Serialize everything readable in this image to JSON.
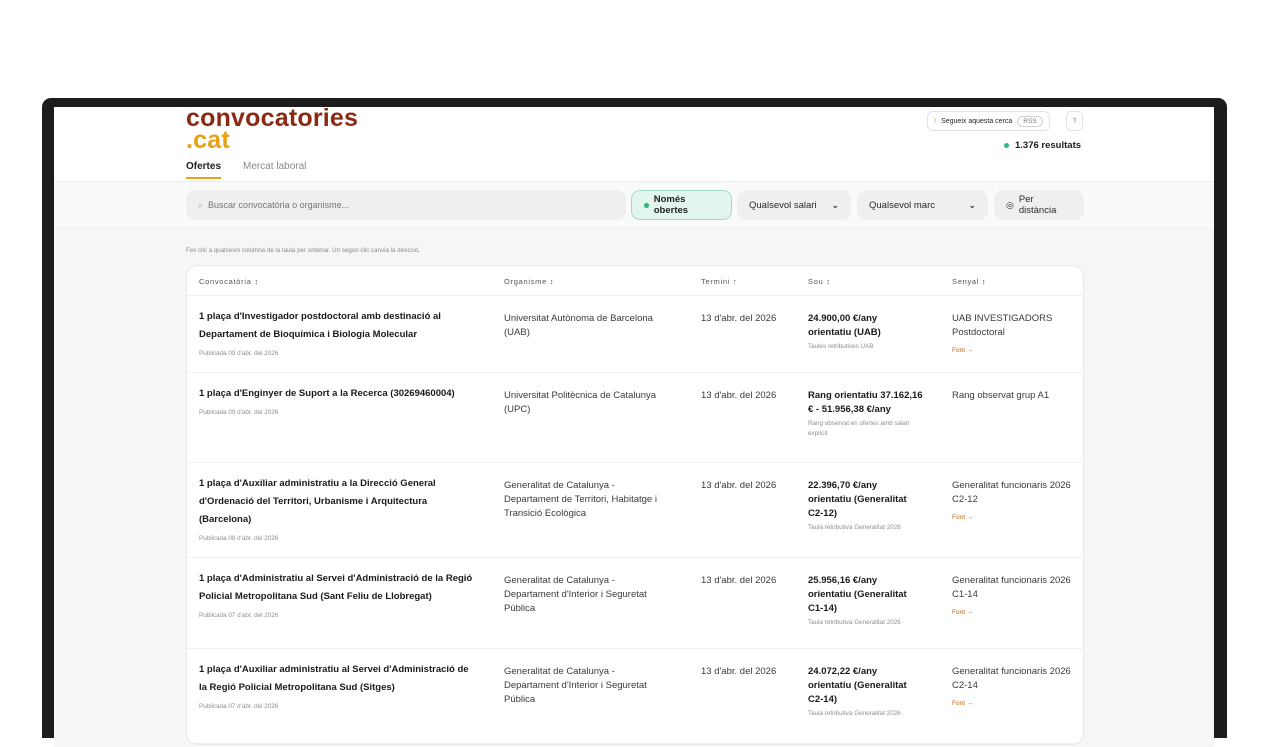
{
  "logo": {
    "line1": "convocatories",
    "line2": ".cat"
  },
  "tabs": [
    {
      "label": "Ofertes",
      "active": true
    },
    {
      "label": "Mercat laboral",
      "active": false
    }
  ],
  "header": {
    "follow_label": "Segueix aquesta cerca",
    "rss_label": "RSS",
    "help_label": "?",
    "results_label": "1.376 resultats"
  },
  "filters": {
    "search_placeholder": "Buscar convocatòria o organisme...",
    "open_label": "Només obertes",
    "salary_label": "Qualsevol salari",
    "marc_label": "Qualsevol marc",
    "distance_label": "Per distància"
  },
  "hint": "Fes clic a qualsevol columna de la taula per ordenar. Un segon clic canvia la direcció.",
  "table": {
    "headers": [
      "Convocatòria ↕",
      "Organisme ↕",
      "Termini ↑",
      "Sou ↕",
      "Senyal ↕"
    ],
    "rows": [
      {
        "title": "1 plaça d'Investigador postdoctoral amb destinació al Departament de Bioquímica i Biologia Molecular",
        "published": "Publicada 09 d'abr. del 2026",
        "org": "Universitat Autònoma de Barcelona (UAB)",
        "deadline": "13 d'abr. del 2026",
        "salary": "24.900,00 €/any orientatiu (UAB)",
        "salary_note": "Taules retributives UAB",
        "signal": "UAB INVESTIGADORS Postdoctoral",
        "font": "Font →"
      },
      {
        "title": "1 plaça d'Enginyer de Suport a la Recerca (30269460004)",
        "published": "Publicada 09 d'abr. del 2026",
        "org": "Universitat Politècnica de Catalunya (UPC)",
        "deadline": "13 d'abr. del 2026",
        "salary": "Rang orientatiu 37.162,16 € - 51.956,38 €/any",
        "salary_note": "Rang observat en ofertes amb salari explícit",
        "signal": "Rang observat grup A1",
        "font": ""
      },
      {
        "title": "1 plaça d'Auxiliar administratiu a la Direcció General d'Ordenació del Territori, Urbanisme i Arquitectura (Barcelona)",
        "published": "Publicada 08 d'abr. del 2026",
        "org": "Generalitat de Catalunya - Departament de Territori, Habitatge i Transició Ecològica",
        "deadline": "13 d'abr. del 2026",
        "salary": "22.396,70 €/any orientatiu (Generalitat C2-12)",
        "salary_note": "Taula retributiva Generalitat 2026",
        "signal": "Generalitat funcionaris 2026 C2-12",
        "font": "Font →"
      },
      {
        "title": "1 plaça d'Administratiu al Servei d'Administració de la Regió Policial Metropolitana Sud (Sant Feliu de Llobregat)",
        "published": "Publicada 07 d'abr. del 2026",
        "org": "Generalitat de Catalunya - Departament d'Interior i Seguretat Pública",
        "deadline": "13 d'abr. del 2026",
        "salary": "25.956,16 €/any orientatiu (Generalitat C1-14)",
        "salary_note": "Taula retributiva Generalitat 2026",
        "signal": "Generalitat funcionaris 2026 C1-14",
        "font": "Font →"
      },
      {
        "title": "1 plaça d'Auxiliar administratiu al Servei d'Administració de la Regió Policial Metropolitana Sud (Sitges)",
        "published": "Publicada 07 d'abr. del 2026",
        "org": "Generalitat de Catalunya - Departament d'Interior i Seguretat Pública",
        "deadline": "13 d'abr. del 2026",
        "salary": "24.072,22 €/any orientatiu (Generalitat C2-14)",
        "salary_note": "Taula retributiva Generalitat 2026",
        "signal": "Generalitat funcionaris 2026 C2-14",
        "font": "Font →"
      }
    ]
  },
  "colors": {
    "brand_red": "#8b2a14",
    "brand_yellow": "#e6a117",
    "status_green": "#2fb67a",
    "link_orange": "#c2671a"
  }
}
